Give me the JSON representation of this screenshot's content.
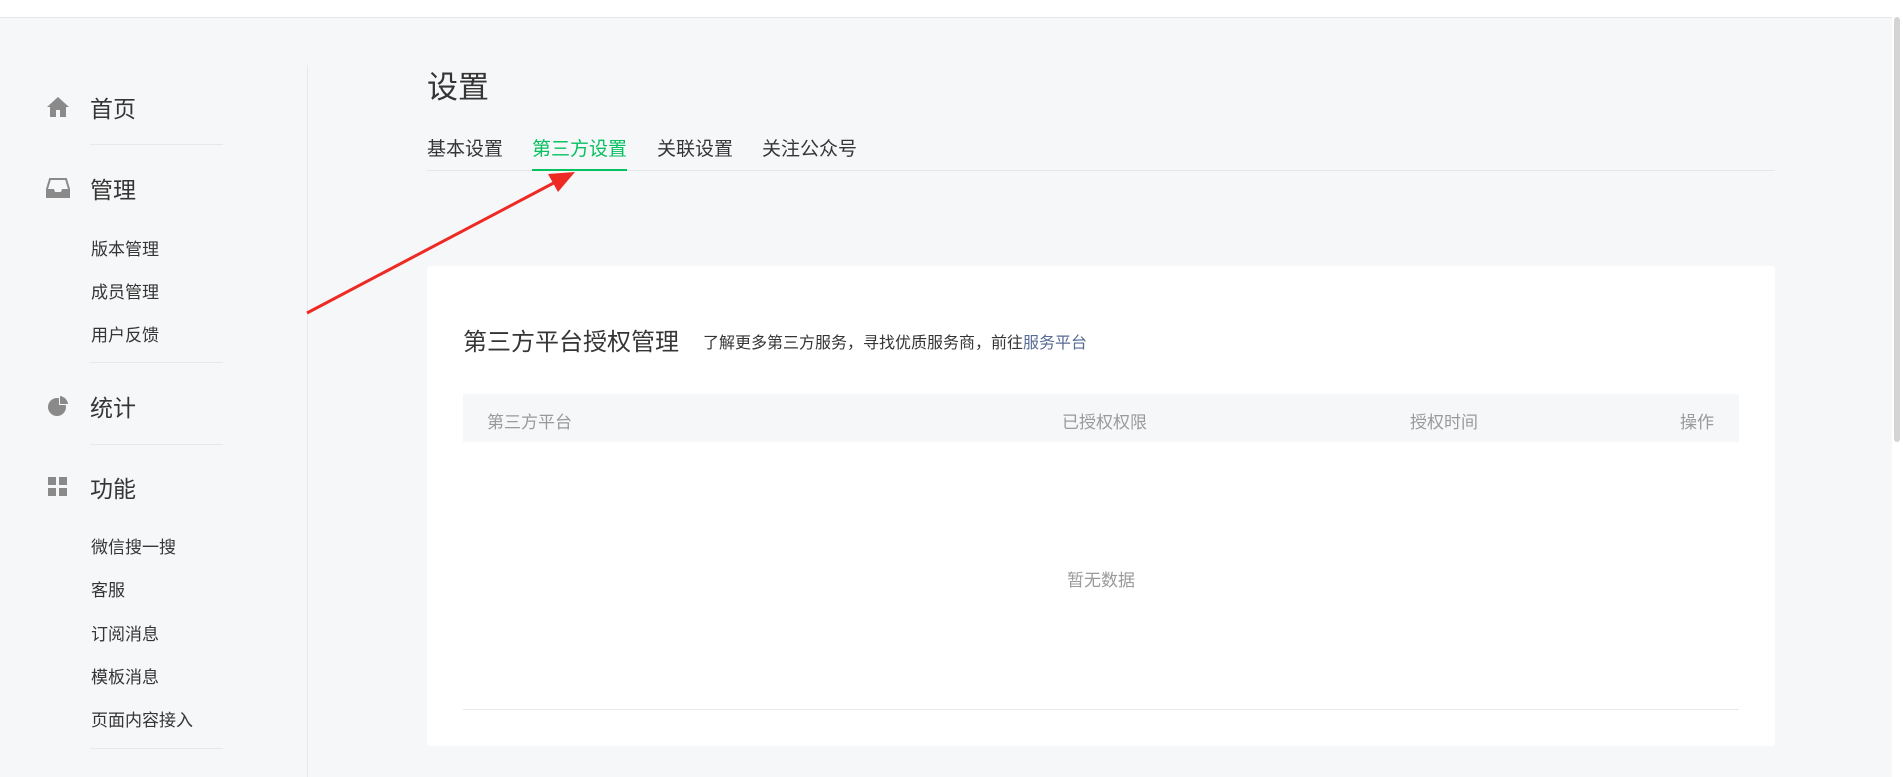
{
  "sidebar": {
    "home": "首页",
    "manage": "管理",
    "manage_items": [
      "版本管理",
      "成员管理",
      "用户反馈"
    ],
    "stats": "统计",
    "features": "功能",
    "feature_items": [
      "微信搜一搜",
      "客服",
      "订阅消息",
      "模板消息",
      "页面内容接入"
    ]
  },
  "main": {
    "title": "设置",
    "tabs": [
      "基本设置",
      "第三方设置",
      "关联设置",
      "关注公众号"
    ],
    "active_tab": "第三方设置"
  },
  "card": {
    "title": "第三方平台授权管理",
    "desc": "了解更多第三方服务，寻找优质服务商，前往",
    "desc_link": "服务平台",
    "columns": [
      "第三方平台",
      "已授权权限",
      "授权时间",
      "操作"
    ],
    "empty_text": "暂无数据"
  },
  "colors": {
    "accent": "#07c160",
    "link": "#576b95",
    "annotation_arrow": "#ee2a24"
  }
}
